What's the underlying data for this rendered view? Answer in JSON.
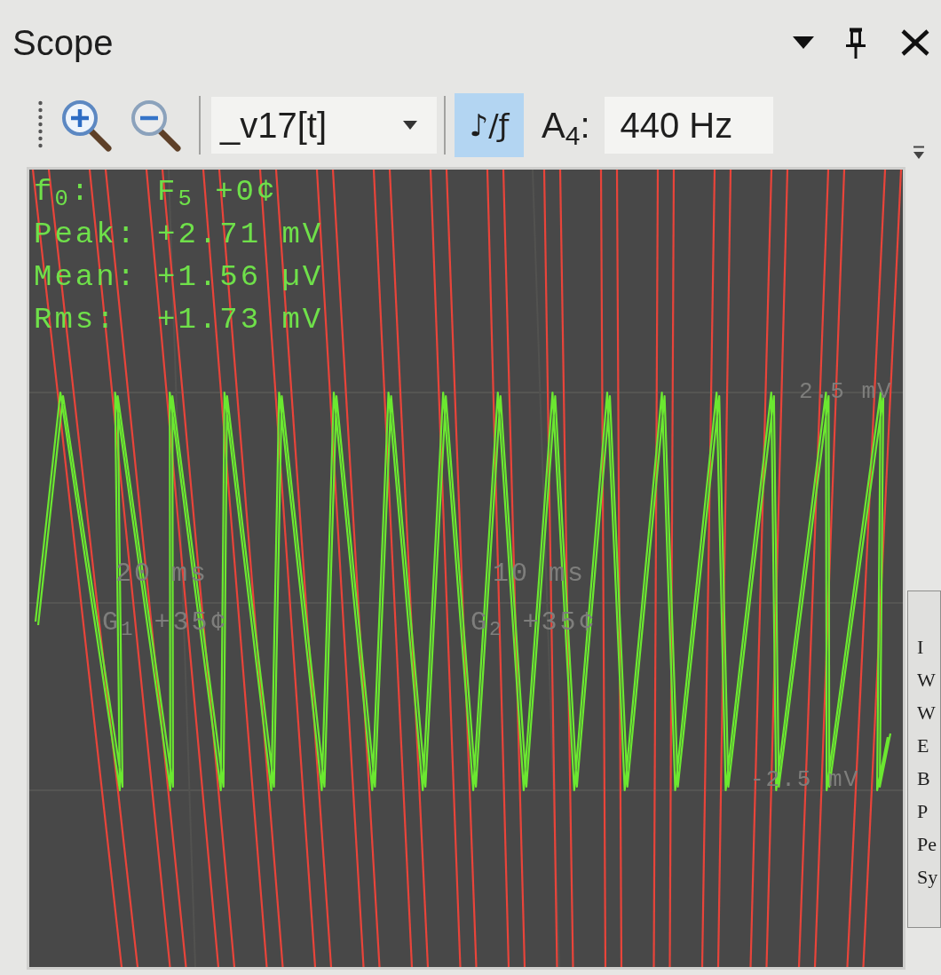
{
  "window": {
    "title": "Scope"
  },
  "toolbar": {
    "signal_select": {
      "value": "_v17[t]"
    },
    "note_toggle": {
      "label": "♪/ƒ",
      "on": true
    },
    "reference_pitch": {
      "label": "A$_{4}$:",
      "value": "440 Hz"
    }
  },
  "scope": {
    "readouts": [
      {
        "label": "f$_{0}$:",
        "value": "F$_{5}$ +0¢"
      },
      {
        "label": "Peak:",
        "value": "+2.71 mV"
      },
      {
        "label": "Mean:",
        "value": "+1.56 µV"
      },
      {
        "label": "Rms:",
        "value": "+1.73 mV"
      }
    ],
    "time_labels": [
      {
        "time": "20 ms",
        "pitch": "G$_{1}$ +35¢"
      },
      {
        "time": "10 ms",
        "pitch": "G$_{2}$ +35¢"
      }
    ],
    "level_labels": [
      "2.5 mV",
      "-2.5 mV"
    ]
  },
  "side_panel": {
    "items": [
      "I",
      "W",
      "W",
      "E",
      "B",
      "P",
      "Pe",
      "Sy"
    ]
  }
}
